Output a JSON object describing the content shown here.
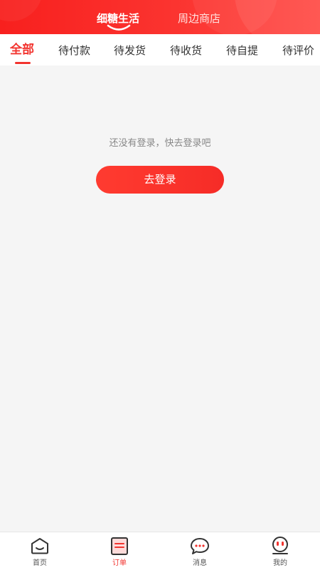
{
  "header": {
    "tabs": [
      {
        "label": "细糖生活",
        "active": true
      },
      {
        "label": "周边商店",
        "active": false
      }
    ],
    "accent_color": "#f8201e"
  },
  "order_tabs": [
    {
      "label": "全部",
      "active": true
    },
    {
      "label": "待付款",
      "active": false
    },
    {
      "label": "待发货",
      "active": false
    },
    {
      "label": "待收货",
      "active": false
    },
    {
      "label": "待自提",
      "active": false
    },
    {
      "label": "待评价",
      "active": false
    }
  ],
  "empty_state": {
    "message": "还没有登录，快去登录吧",
    "login_button": "去登录"
  },
  "bottom_nav": [
    {
      "label": "首页",
      "icon": "home-icon",
      "active": false
    },
    {
      "label": "订单",
      "icon": "order-icon",
      "active": true
    },
    {
      "label": "消息",
      "icon": "message-icon",
      "active": false
    },
    {
      "label": "我的",
      "icon": "profile-icon",
      "active": false
    }
  ]
}
